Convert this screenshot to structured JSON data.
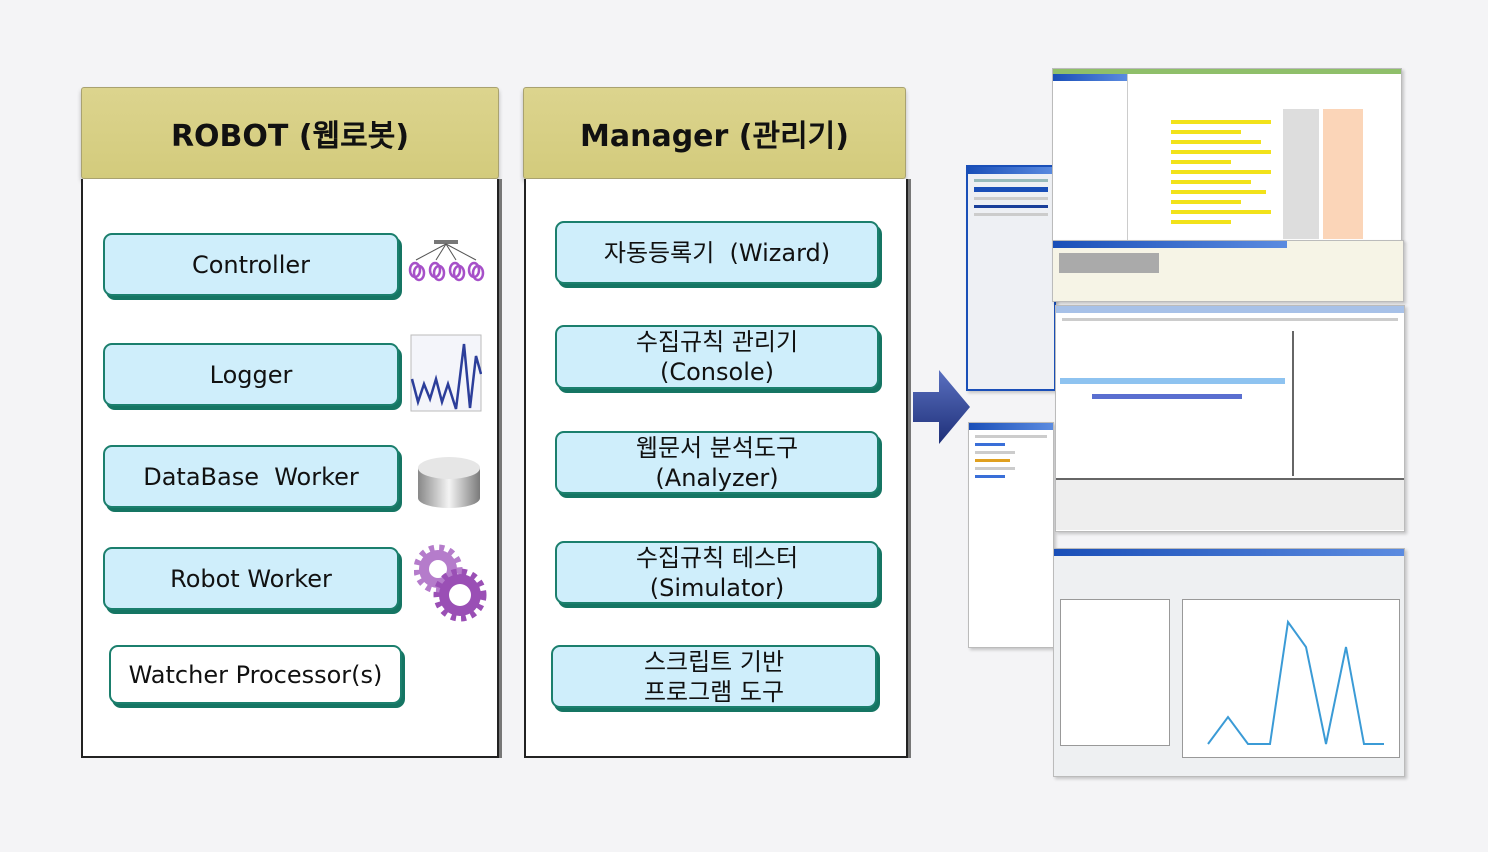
{
  "robot": {
    "title": "ROBOT (웹로봇)",
    "items": [
      "Controller",
      "Logger",
      "DataBase  Worker",
      "Robot Worker",
      "Watcher Processor(s)"
    ],
    "icons": [
      "hierarchy-icon",
      "line-graph-icon",
      "database-icon",
      "gears-icon"
    ]
  },
  "manager": {
    "title": "Manager (관리기)",
    "items": [
      {
        "line1": "자동등록기  (Wizard)",
        "line2": ""
      },
      {
        "line1": "수집규칙 관리기",
        "line2": "(Console)"
      },
      {
        "line1": "웹문서 분석도구",
        "line2": "(Analyzer)"
      },
      {
        "line1": "수집규칙 테스터",
        "line2": "(Simulator)"
      },
      {
        "line1": "스크립트 기반",
        "line2": "프로그램 도구"
      }
    ]
  },
  "colors": {
    "header": "#d8d085",
    "box_fill": "#cfeefb",
    "box_border": "#1b7f6d",
    "arrow": "#2a3f8f"
  }
}
